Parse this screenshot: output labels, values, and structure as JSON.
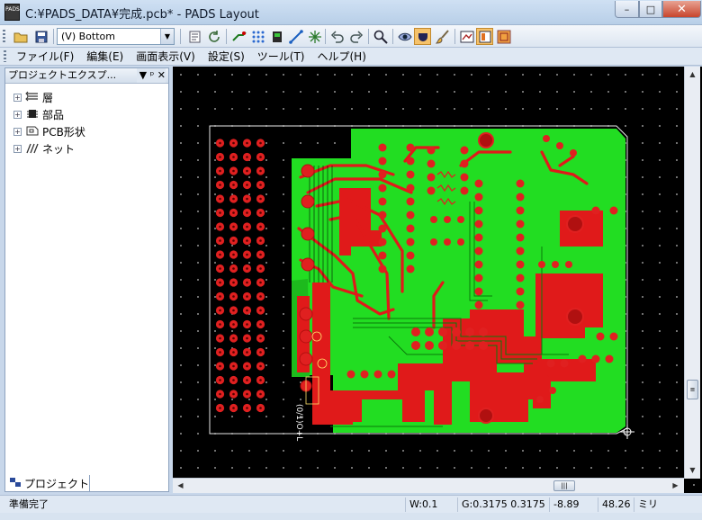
{
  "window": {
    "title": "C:¥PADS_DATA¥完成.pcb* - PADS Layout",
    "logo_text": "PADS",
    "controls": {
      "minimize": "–",
      "maximize": "□",
      "close": "✕"
    }
  },
  "toolbar": {
    "layer_selector": "(V) Bottom",
    "buttons": [
      "open-folder-icon",
      "save-icon",
      "properties-icon",
      "refresh-icon",
      "route-icon",
      "autoroute-icon",
      "component-icon",
      "diagonal-route-icon",
      "design-rule-icon",
      "undo-icon",
      "redo-icon",
      "zoom-icon",
      "view-icon",
      "highlight-icon",
      "brush-icon",
      "redraw-icon",
      "layout-icon",
      "settings-icon"
    ]
  },
  "menu": {
    "items": [
      "ファイル(F)",
      "編集(E)",
      "画面表示(V)",
      "設定(S)",
      "ツール(T)",
      "ヘルプ(H)"
    ]
  },
  "project_panel": {
    "title": "プロジェクトエクスプ...",
    "header_buttons": [
      "▼",
      "ᵖ",
      "✕"
    ],
    "tree": [
      {
        "label": "層",
        "icon": "layers-icon"
      },
      {
        "label": "部品",
        "icon": "component-icon"
      },
      {
        "label": "PCB形状",
        "icon": "board-outline-icon"
      },
      {
        "label": "ネット",
        "icon": "nets-icon"
      }
    ],
    "tab_label": "プロジェクト"
  },
  "status_bar": {
    "status": "準備完了",
    "width": "W:0.1",
    "grid": "G:0.3175 0.3175",
    "coord_x": "-8.89",
    "coord_y": "48.26",
    "units": "ミリ"
  },
  "pcb_label": "(0/1)O+L"
}
